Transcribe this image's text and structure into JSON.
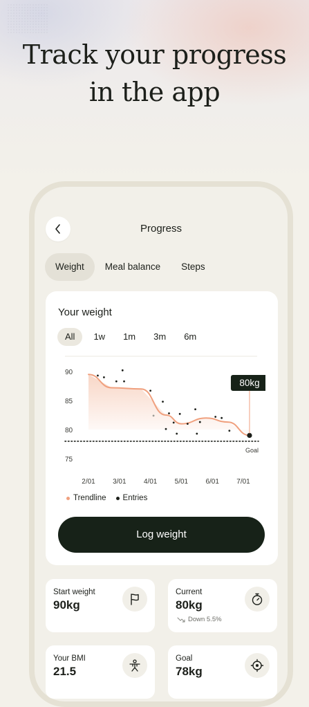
{
  "headline": {
    "line1": "Track your progress",
    "line2": "in the app"
  },
  "screen": {
    "title": "Progress"
  },
  "tabs": [
    {
      "label": "Weight",
      "active": true
    },
    {
      "label": "Meal balance",
      "active": false
    },
    {
      "label": "Steps",
      "active": false
    }
  ],
  "weight_card": {
    "title": "Your weight",
    "ranges": [
      {
        "label": "All",
        "active": true
      },
      {
        "label": "1w",
        "active": false
      },
      {
        "label": "1m",
        "active": false
      },
      {
        "label": "3m",
        "active": false
      },
      {
        "label": "6m",
        "active": false
      }
    ],
    "legend": {
      "trendline": "Trendline",
      "entries": "Entries"
    },
    "log_button": "Log weight"
  },
  "chart_data": {
    "type": "line",
    "x_ticks": [
      "2/01",
      "3/01",
      "4/01",
      "5/01",
      "6/01",
      "7/01"
    ],
    "y_ticks": [
      90,
      85,
      80,
      75
    ],
    "ylim": [
      74,
      91
    ],
    "goal": {
      "value": 78,
      "label": "Goal"
    },
    "callout": "80kg",
    "series": [
      {
        "name": "Trendline",
        "color": "#f0a07e",
        "points": [
          {
            "x": 1.0,
            "y": 89.5
          },
          {
            "x": 1.75,
            "y": 87.2
          },
          {
            "x": 2.7,
            "y": 87.0
          },
          {
            "x": 3.5,
            "y": 82.5
          },
          {
            "x": 4.0,
            "y": 81.0
          },
          {
            "x": 4.8,
            "y": 82.0
          },
          {
            "x": 5.5,
            "y": 81.3
          },
          {
            "x": 6.2,
            "y": 79.0
          }
        ]
      },
      {
        "name": "Entries",
        "color": "#1c1f1a",
        "points": [
          {
            "x": 1.3,
            "y": 89.3
          },
          {
            "x": 1.5,
            "y": 89.0
          },
          {
            "x": 1.9,
            "y": 88.3
          },
          {
            "x": 2.1,
            "y": 90.2
          },
          {
            "x": 2.15,
            "y": 88.3
          },
          {
            "x": 3.0,
            "y": 86.7
          },
          {
            "x": 3.1,
            "y": 82.4
          },
          {
            "x": 3.4,
            "y": 84.8
          },
          {
            "x": 3.5,
            "y": 80.1
          },
          {
            "x": 3.6,
            "y": 82.8
          },
          {
            "x": 3.75,
            "y": 81.2
          },
          {
            "x": 3.85,
            "y": 79.3
          },
          {
            "x": 3.95,
            "y": 82.7
          },
          {
            "x": 4.2,
            "y": 81.0
          },
          {
            "x": 4.45,
            "y": 83.5
          },
          {
            "x": 4.5,
            "y": 79.3
          },
          {
            "x": 4.6,
            "y": 81.3
          },
          {
            "x": 5.1,
            "y": 82.2
          },
          {
            "x": 5.3,
            "y": 82.0
          },
          {
            "x": 5.55,
            "y": 79.8
          },
          {
            "x": 6.2,
            "y": 79.0
          }
        ]
      }
    ]
  },
  "stats": [
    {
      "label": "Start weight",
      "value": "90kg",
      "sub": "",
      "icon": "flag-icon"
    },
    {
      "label": "Current",
      "value": "80kg",
      "sub": "Down 5.5%",
      "icon": "stopwatch-icon"
    },
    {
      "label": "Your BMI",
      "value": "21.5",
      "sub": "",
      "icon": "body-icon"
    },
    {
      "label": "Goal",
      "value": "78kg",
      "sub": "",
      "icon": "target-icon"
    }
  ],
  "colors": {
    "accent": "#f0a07e",
    "dark": "#172218",
    "background": "#f3f1ea",
    "card": "#ffffff"
  }
}
